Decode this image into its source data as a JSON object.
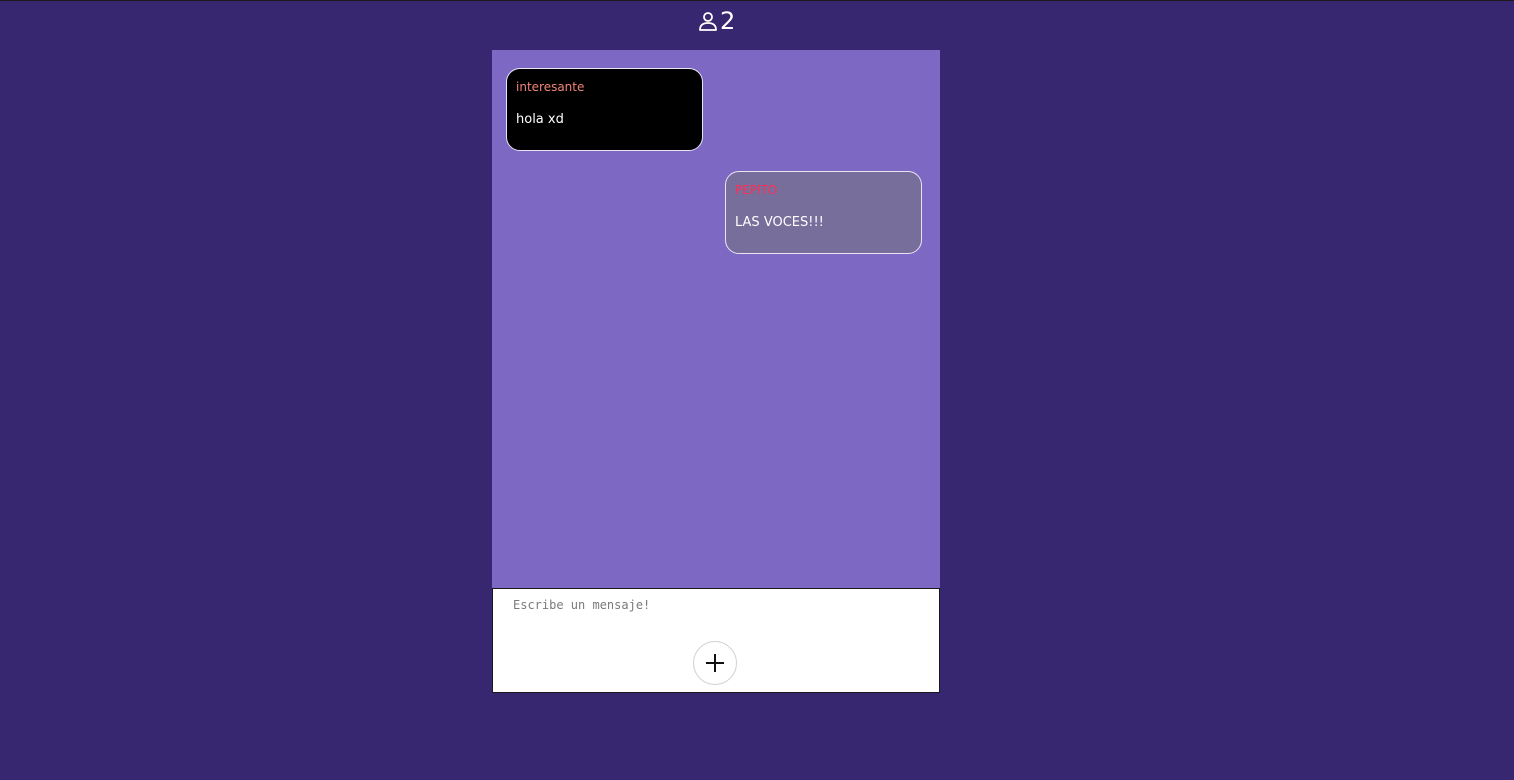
{
  "header": {
    "user_icon": "user-icon",
    "online_count": "2"
  },
  "messages": [
    {
      "author": "interesante",
      "text": "hola xd",
      "side": "left",
      "author_color": "#f08477",
      "bg": "#000000"
    },
    {
      "author": "PEPITO",
      "text": "LAS VOCES!!!",
      "side": "right",
      "author_color": "#ff2d55",
      "bg": "#786e9b"
    }
  ],
  "composer": {
    "placeholder": "Escribe un mensaje!",
    "value": "",
    "add_icon": "plus-icon"
  },
  "colors": {
    "page_background": "#372770",
    "chat_background": "#7d69c4"
  }
}
